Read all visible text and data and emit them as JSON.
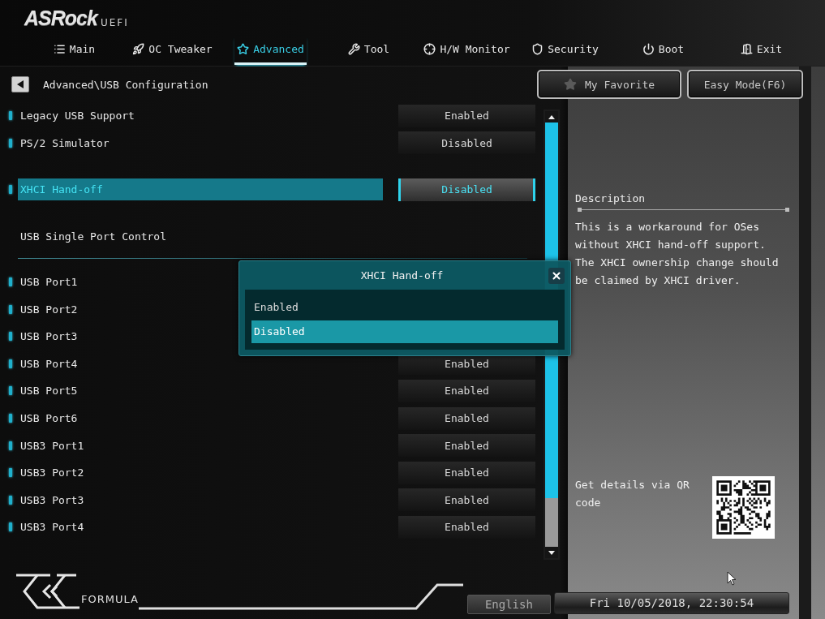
{
  "header": {
    "logo": "ASRock",
    "logo_suffix": "UEFI"
  },
  "tabs": [
    {
      "label": "Main",
      "selected": false
    },
    {
      "label": "OC Tweaker",
      "selected": false
    },
    {
      "label": "Advanced",
      "selected": true
    },
    {
      "label": "Tool",
      "selected": false
    },
    {
      "label": "H/W Monitor",
      "selected": false
    },
    {
      "label": "Security",
      "selected": false
    },
    {
      "label": "Boot",
      "selected": false
    },
    {
      "label": "Exit",
      "selected": false
    }
  ],
  "toolbar": {
    "breadcrumb": "Advanced\\USB Configuration",
    "favorite_button": "My Favorite",
    "mode_button": "Easy Mode(F6)"
  },
  "settings": [
    {
      "items": [
        {
          "kind": "option",
          "label": "Legacy USB Support",
          "value": "Enabled",
          "selected": false
        },
        {
          "kind": "option",
          "label": "PS/2 Simulator",
          "value": "Disabled",
          "selected": false
        }
      ]
    },
    {
      "items": [
        {
          "kind": "option",
          "label": "XHCI Hand-off",
          "value": "Disabled",
          "selected": true
        }
      ]
    },
    {
      "items": [
        {
          "kind": "heading",
          "label": "USB Single Port Control"
        },
        {
          "kind": "option",
          "label": "USB Port1",
          "selected": false
        },
        {
          "kind": "option",
          "label": "USB Port2",
          "selected": false
        },
        {
          "kind": "option",
          "label": "USB Port3",
          "selected": false
        },
        {
          "kind": "option",
          "label": "USB Port4",
          "value": "Enabled",
          "selected": false
        },
        {
          "kind": "option",
          "label": "USB Port5",
          "value": "Enabled",
          "selected": false
        },
        {
          "kind": "option",
          "label": "USB Port6",
          "value": "Enabled",
          "selected": false
        },
        {
          "kind": "option",
          "label": "USB3 Port1",
          "value": "Enabled",
          "selected": false
        },
        {
          "kind": "option",
          "label": "USB3 Port2",
          "value": "Enabled",
          "selected": false
        },
        {
          "kind": "option",
          "label": "USB3 Port3",
          "value": "Enabled",
          "selected": false
        },
        {
          "kind": "option",
          "label": "USB3 Port4",
          "value": "Enabled",
          "selected": false
        }
      ]
    }
  ],
  "popup": {
    "title": "XHCI Hand-off",
    "options": [
      {
        "label": "Enabled",
        "selected": false
      },
      {
        "label": "Disabled",
        "selected": true
      }
    ]
  },
  "description": {
    "heading": "Description",
    "text": "This is a workaround for OSes without XHCI hand-off support. The XHCI ownership change should be claimed by XHCI driver."
  },
  "qr": {
    "caption": "Get details via QR code"
  },
  "footer": {
    "logo": "FORMULA",
    "language": "English",
    "datetime": "Fri 10/05/2018, 22:30:54"
  }
}
